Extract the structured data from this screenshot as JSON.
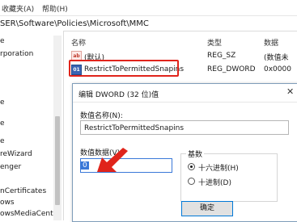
{
  "menubar": {
    "favorites": "收藏夹(A)",
    "help": "帮助(H)"
  },
  "address": "SER\\Software\\Policies\\Microsoft\\MMC",
  "tree": {
    "items": [
      "e",
      "rporation",
      "e",
      "e",
      "e",
      "reWizard",
      "enger",
      "nCertificates",
      "ows",
      "owsMediaCenter"
    ]
  },
  "list": {
    "headers": {
      "name": "名称",
      "type": "类型",
      "data": "数据"
    },
    "rows": [
      {
        "icon": "string-value-icon",
        "name": "(默认)",
        "type": "REG_SZ",
        "data": "(数值未"
      },
      {
        "icon": "dword-value-icon",
        "name": "RestrictToPermittedSnapins",
        "type": "REG_DWORD",
        "data": "0x0000"
      }
    ]
  },
  "dialog": {
    "title": "编辑 DWORD (32 位)值",
    "close": "✕",
    "value_name_label": "数值名称(N):",
    "value_name": "RestrictToPermittedSnapins",
    "value_data_label": "数值数据(V):",
    "value_data": "0",
    "base_label": "基数",
    "base_options": [
      {
        "label": "十六进制(H)",
        "selected": true
      },
      {
        "label": "十进制(D)",
        "selected": false
      }
    ],
    "ok": "确定"
  },
  "colors": {
    "highlight": "#e0241b",
    "accent": "#3a78d8"
  }
}
